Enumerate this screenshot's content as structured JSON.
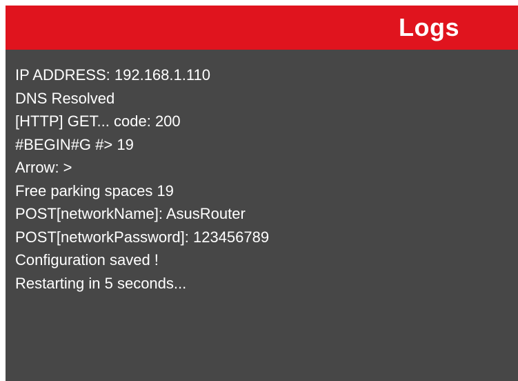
{
  "header": {
    "title": "Logs",
    "background_color": "#e0141e"
  },
  "log": {
    "background_color": "#474747",
    "lines": [
      "IP ADDRESS: 192.168.1.110",
      "DNS Resolved",
      "[HTTP] GET... code: 200",
      "#BEGIN#G #> 19",
      "Arrow: >",
      "Free parking spaces 19",
      "POST[networkName]: AsusRouter",
      "POST[networkPassword]: 123456789",
      "Configuration saved !",
      "Restarting in 5 seconds..."
    ]
  }
}
